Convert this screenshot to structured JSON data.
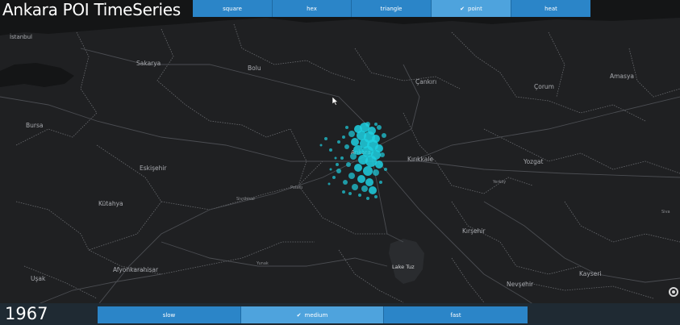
{
  "app": {
    "title": "Ankara POI TimeSeries"
  },
  "shape_tabs": [
    {
      "label": "square",
      "active": false
    },
    {
      "label": "hex",
      "active": false
    },
    {
      "label": "triangle",
      "active": false
    },
    {
      "label": "point",
      "active": true
    },
    {
      "label": "heat",
      "active": false
    }
  ],
  "year": "1967",
  "speed_tabs": [
    {
      "label": "slow",
      "active": false
    },
    {
      "label": "medium",
      "active": true
    },
    {
      "label": "fast",
      "active": false
    }
  ],
  "map": {
    "places": {
      "istanbul": "İstanbul",
      "sakarya": "Sakarya",
      "bolu": "Bolu",
      "cankiri": "Çankırı",
      "corum": "Çorum",
      "amasya": "Amasya",
      "bursa": "Bursa",
      "eskisehir": "Eskişehir",
      "kirikkale": "Kırıkkale",
      "yozgat": "Yozgat",
      "kutahya": "Kütahya",
      "polatli": "Polatlı",
      "sivrihisar": "Sivrihisar",
      "ankara": "Ankara",
      "yerkoy": "Yerköy",
      "kirsehir": "Kırşehir",
      "afyonkarahisar": "Afyonkarahisar",
      "usak": "Uşak",
      "yunak": "Yunak",
      "lake_tuz": "Lake Tuz",
      "kayseri": "Kayseri",
      "nevsehir": "Nevşehir",
      "sivas": "Siva"
    },
    "point_color": "#1fd0e0",
    "background_color": "#1f2022"
  },
  "colors": {
    "accent": "#2b85c8",
    "accent_active": "#4ea3dd"
  }
}
